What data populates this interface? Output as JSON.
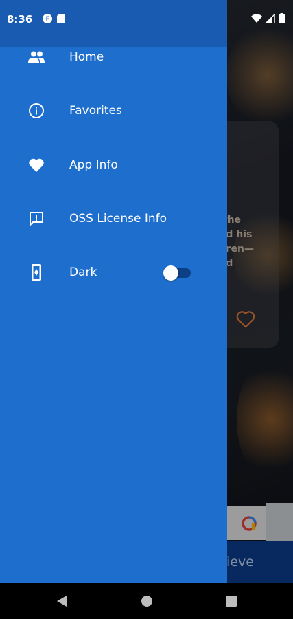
{
  "status_bar": {
    "time": "8:36",
    "icons_left": [
      "f-notification-icon",
      "sd-card-icon"
    ],
    "icons_right": [
      "wifi-icon",
      "signal-icon",
      "battery-icon"
    ]
  },
  "drawer": {
    "background_color": "#1e6fcd",
    "header_color": "#195bb0",
    "items": [
      {
        "label": "Home",
        "icon": "people-icon"
      },
      {
        "label": "Favorites",
        "icon": "info-icon"
      },
      {
        "label": "App Info",
        "icon": "heart-icon"
      },
      {
        "label": "OSS License Info",
        "icon": "feedback-icon"
      },
      {
        "label": "Dark",
        "icon": "phone-theme-icon",
        "toggle": false
      }
    ]
  },
  "background_app": {
    "card_text": "g the\nand his\nildren—\nand",
    "bottom_bar_text": "ieve",
    "accent_color": "#e07a3c"
  },
  "nav_bar": {
    "buttons": [
      "back-icon",
      "home-icon",
      "recents-icon"
    ]
  }
}
